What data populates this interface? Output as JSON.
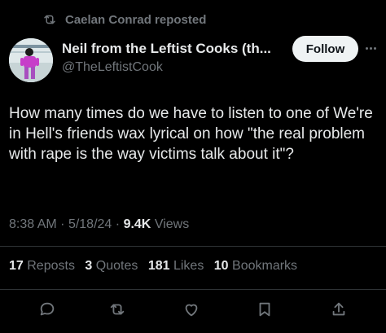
{
  "repost": {
    "text": "Caelan Conrad reposted",
    "icon": "repost-icon"
  },
  "author": {
    "display_name": "Neil from the Leftist Cooks (th...",
    "handle": "@TheLeftistCook",
    "avatar": "avatar-image"
  },
  "follow_label": "Follow",
  "more_icon": "more-icon",
  "tweet": {
    "text": "How many times do we have to listen to one of We're in Hell's friends wax lyrical on how \"the real problem with rape is the way victims talk about it\"?",
    "time": "8:38 AM",
    "date": "5/18/24",
    "views_count": "9.4K",
    "views_label": "Views"
  },
  "stats": {
    "reposts_count": "17",
    "reposts_label": "Reposts",
    "quotes_count": "3",
    "quotes_label": "Quotes",
    "likes_count": "181",
    "likes_label": "Likes",
    "bookmarks_count": "10",
    "bookmarks_label": "Bookmarks"
  },
  "actions": [
    "reply-icon",
    "repost-icon",
    "like-icon",
    "bookmark-icon",
    "share-icon"
  ],
  "colors": {
    "background": "#000000",
    "text": "#e7e9ea",
    "muted": "#71767b",
    "follow_bg": "#eff3f4",
    "divider": "#2f3336"
  }
}
